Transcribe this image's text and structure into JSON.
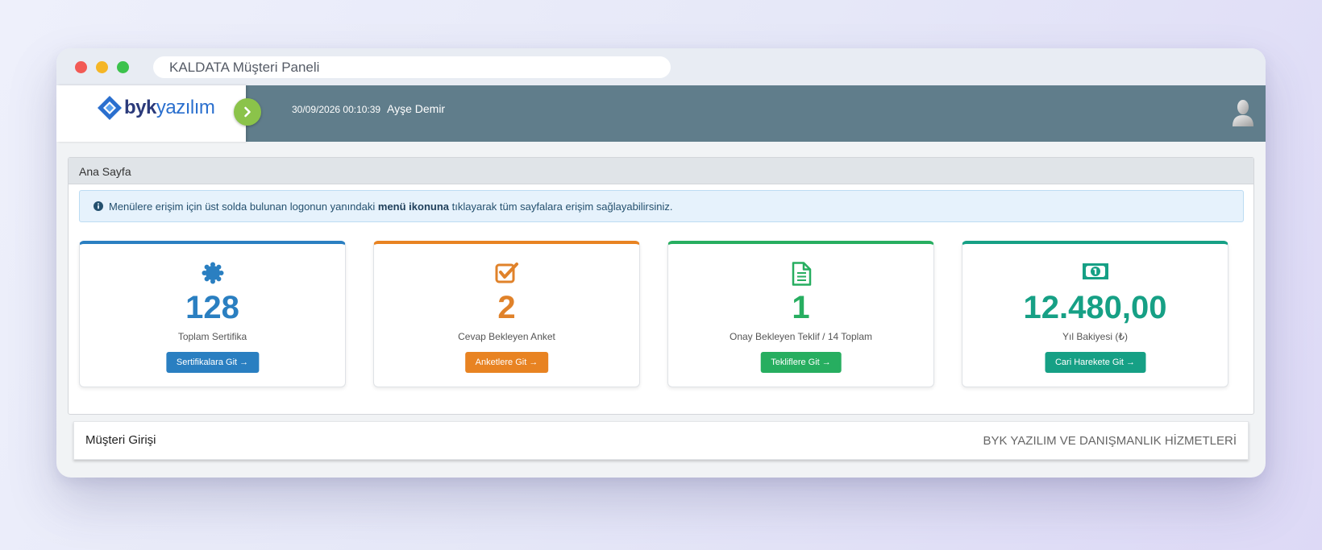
{
  "window": {
    "address": "KALDATA Müşteri Paneli"
  },
  "header": {
    "logo": {
      "brand_bold": "byk",
      "brand_light": "yazılım"
    },
    "datetime": "30/09/2026 00:10:39",
    "user_name": "Ayşe Demir"
  },
  "panel": {
    "title": "Ana Sayfa",
    "alert": {
      "before": "Menülere erişim için üst solda bulunan logonun yanındaki",
      "bold": "menü ikonuna",
      "after": "tıklayarak tüm sayfalara erişim sağlayabilirsiniz."
    },
    "cards": [
      {
        "icon": "certificate-icon",
        "value": "128",
        "label": "Toplam Sertifika",
        "button": "Sertifikalara Git →",
        "color": "#2a7fc1"
      },
      {
        "icon": "checkbox-icon",
        "value": "2",
        "label": "Cevap Bekleyen Anket",
        "button": "Anketlere Git →",
        "color": "#e88322"
      },
      {
        "icon": "document-icon",
        "value": "1",
        "label": "Onay Bekleyen Teklif / 14 Toplam",
        "button": "Tekliflere Git →",
        "color": "#27ae60"
      },
      {
        "icon": "money-icon",
        "value": "12.480,00",
        "label": "Yıl Bakiyesi (₺)",
        "button": "Cari Harekete Git →",
        "color": "#16a085"
      }
    ]
  },
  "footer": {
    "left": "Müşteri Girişi",
    "right": "BYK YAZILIM VE DANIŞMANLIK HİZMETLERİ"
  }
}
